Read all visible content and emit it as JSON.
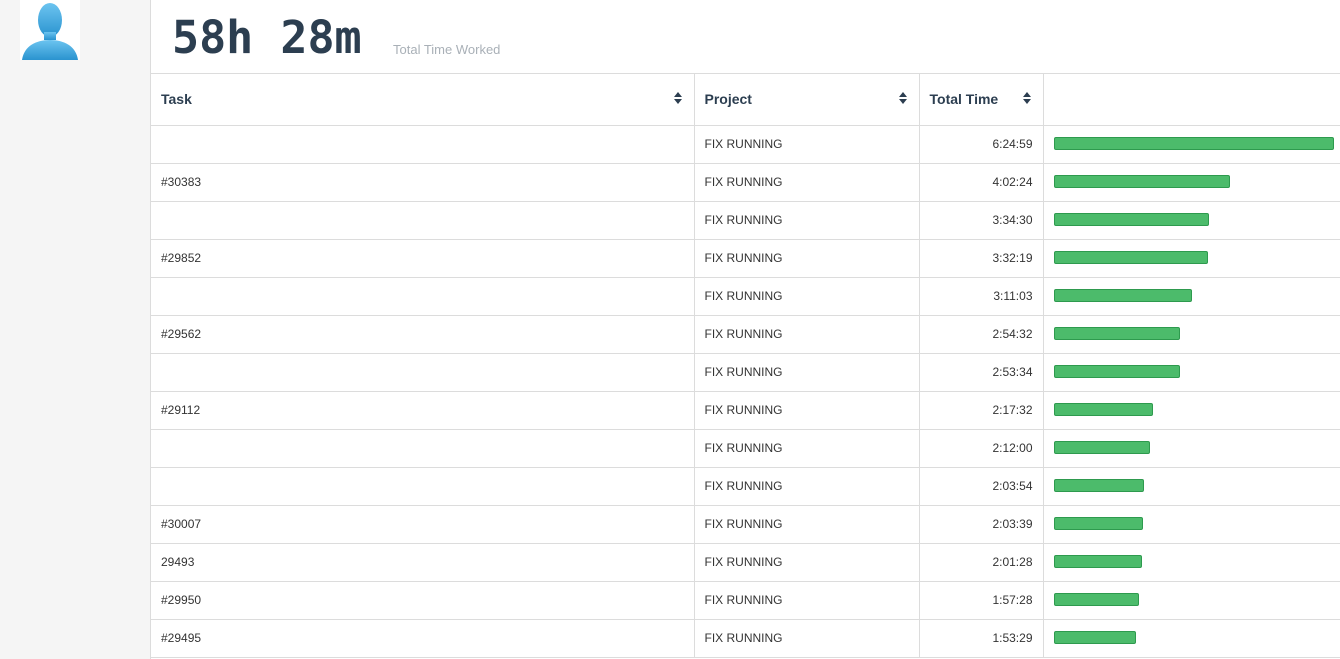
{
  "header": {
    "total": "58h 28m",
    "total_label": "Total Time Worked"
  },
  "columns": {
    "task": "Task",
    "project": "Project",
    "total_time": "Total Time"
  },
  "colors": {
    "bar": "#4cbb6b",
    "bar_border": "#2e9a4e",
    "heading": "#2c3e50"
  },
  "rows": [
    {
      "task": "",
      "project": "FIX RUNNING",
      "time": "6:24:59",
      "fraction": 1.0
    },
    {
      "task": "#30383",
      "project": "FIX RUNNING",
      "time": "4:02:24",
      "fraction": 0.629
    },
    {
      "task": "",
      "project": "FIX RUNNING",
      "time": "3:34:30",
      "fraction": 0.557
    },
    {
      "task": "#29852",
      "project": "FIX RUNNING",
      "time": "3:32:19",
      "fraction": 0.552
    },
    {
      "task": "",
      "project": "FIX RUNNING",
      "time": "3:11:03",
      "fraction": 0.496
    },
    {
      "task": "#29562",
      "project": "FIX RUNNING",
      "time": "2:54:32",
      "fraction": 0.453
    },
    {
      "task": "",
      "project": "FIX RUNNING",
      "time": "2:53:34",
      "fraction": 0.451
    },
    {
      "task": "#29112",
      "project": "FIX RUNNING",
      "time": "2:17:32",
      "fraction": 0.357
    },
    {
      "task": "",
      "project": "FIX RUNNING",
      "time": "2:12:00",
      "fraction": 0.343
    },
    {
      "task": "",
      "project": "FIX RUNNING",
      "time": "2:03:54",
      "fraction": 0.322
    },
    {
      "task": "#30007",
      "project": "FIX RUNNING",
      "time": "2:03:39",
      "fraction": 0.321
    },
    {
      "task": "29493",
      "project": "FIX RUNNING",
      "time": "2:01:28",
      "fraction": 0.315
    },
    {
      "task": "#29950",
      "project": "FIX RUNNING",
      "time": "1:57:28",
      "fraction": 0.305
    },
    {
      "task": "#29495",
      "project": "FIX RUNNING",
      "time": "1:53:29",
      "fraction": 0.295
    }
  ]
}
